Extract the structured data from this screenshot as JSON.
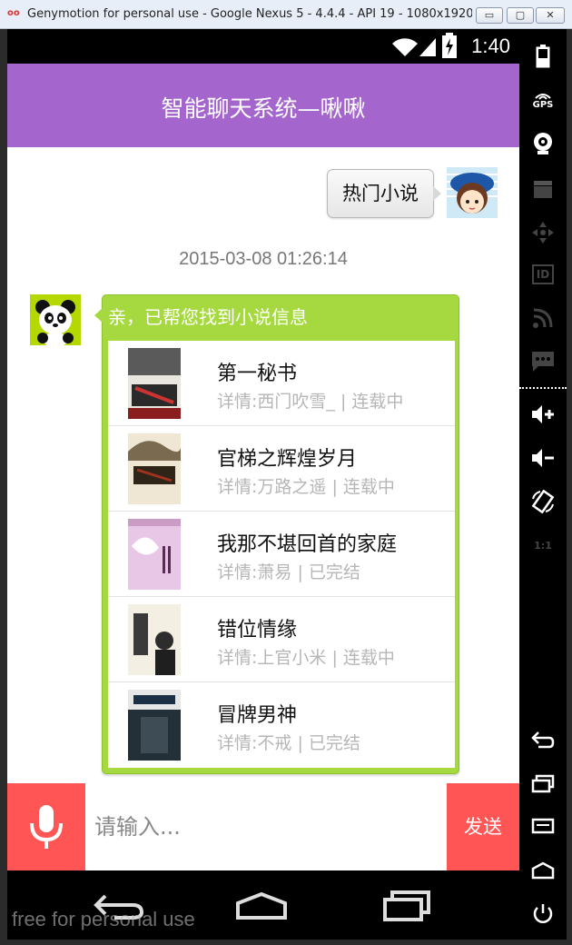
{
  "window": {
    "title": "Genymotion for personal use - Google Nexus 5 - 4.4.4 - API 19 - 1080x1920 (1080...",
    "logo": "genymotion-logo",
    "min": "▭",
    "max": "▢",
    "close": "✕"
  },
  "status_bar": {
    "time": "1:40",
    "icons": [
      "wifi-icon",
      "signal-icon",
      "battery-icon"
    ]
  },
  "app_bar": {
    "title": "智能聊天系统—啾啾"
  },
  "chat": {
    "user_message": "热门小说",
    "timestamp": "2015-03-08 01:26:14",
    "bot_reply": "亲，已帮您找到小说信息",
    "books": [
      {
        "title": "第一秘书",
        "detail": "详情:西门吹雪_ | 连载中"
      },
      {
        "title": "官梯之辉煌岁月",
        "detail": "详情:万路之遥 | 连载中"
      },
      {
        "title": "我那不堪回首的家庭",
        "detail": "详情:萧易 | 已完结"
      },
      {
        "title": "错位情缘",
        "detail": "详情:上官小米 | 连载中"
      },
      {
        "title": "冒牌男神",
        "detail": "详情:不戒 | 已完结"
      }
    ]
  },
  "input_bar": {
    "placeholder": "请输入...",
    "send_label": "发送",
    "mic_icon": "microphone-icon"
  },
  "nav_bar": {
    "icons": [
      "back-icon",
      "home-icon",
      "recents-icon"
    ]
  },
  "side_panel": {
    "gps_label": "GPS",
    "id_label": "ID",
    "scale_label": "1:1"
  },
  "watermark": "free for personal use",
  "colors": {
    "app_bar": "#a466cd",
    "bubble": "#a6d93f",
    "accent": "#ff5555"
  }
}
